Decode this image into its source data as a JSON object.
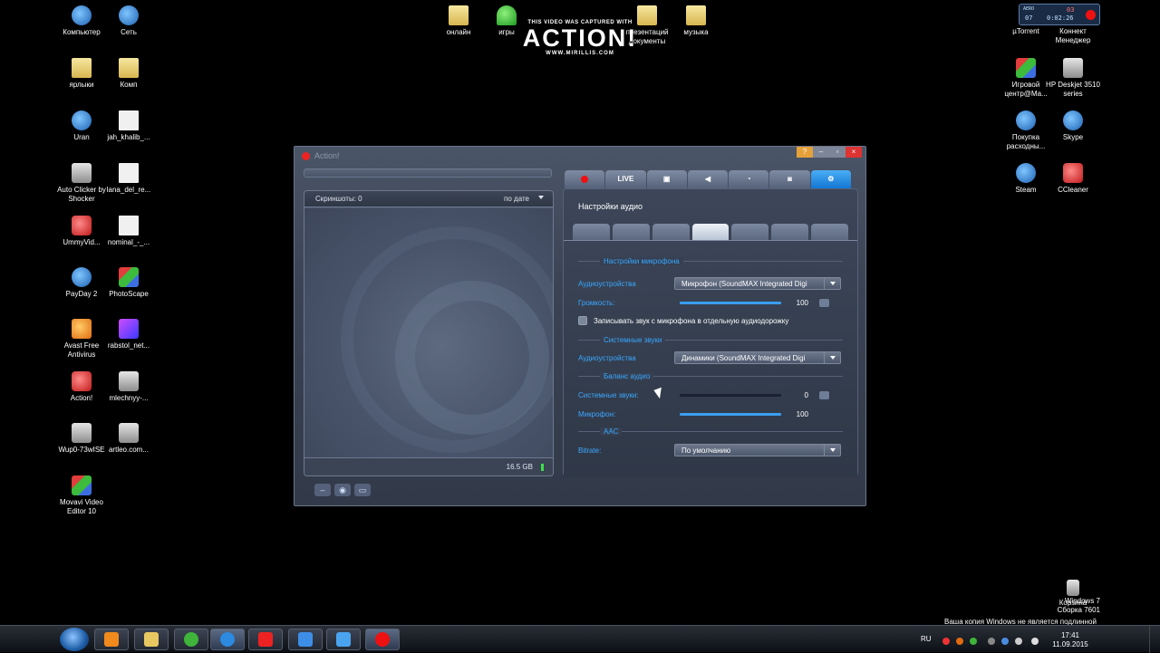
{
  "desktop": {
    "left_icons": [
      {
        "label": "Компьютер",
        "kind": "blue"
      },
      {
        "label": "Сеть",
        "kind": "blue"
      },
      {
        "label": "ярлыки",
        "kind": "folder"
      },
      {
        "label": "Комп",
        "kind": "folder"
      },
      {
        "label": "Uran",
        "kind": "blue"
      },
      {
        "label": "jah_khalib_...",
        "kind": "file"
      },
      {
        "label": "Auto Clicker by Shocker",
        "kind": "gray"
      },
      {
        "label": "lana_del_re...",
        "kind": "file"
      },
      {
        "label": "UmmyVid...",
        "kind": "red"
      },
      {
        "label": "nominal_-_...",
        "kind": "file"
      },
      {
        "label": "PayDay 2",
        "kind": "blue"
      },
      {
        "label": "PhotoScape",
        "kind": "mix"
      },
      {
        "label": "Avast Free Antivirus",
        "kind": "orange"
      },
      {
        "label": "rabstol_net...",
        "kind": "purple"
      },
      {
        "label": "Action!",
        "kind": "red"
      },
      {
        "label": "mlechnyy-...",
        "kind": "gray"
      },
      {
        "label": "Wup0-73wISE",
        "kind": "gray"
      },
      {
        "label": "artleo.com...",
        "kind": "gray"
      },
      {
        "label": "Movavi Video Editor 10",
        "kind": "mix"
      }
    ],
    "top_icons": [
      {
        "label": "онлайн",
        "kind": "folder"
      },
      {
        "label": "игры",
        "kind": "green"
      },
      {
        "label": "презентаций документы",
        "kind": "folder"
      },
      {
        "label": "музыка",
        "kind": "folder"
      }
    ],
    "right_icons": [
      {
        "label": "µTorrent",
        "kind": "green"
      },
      {
        "label": "Коннект Менеджер",
        "kind": "gray"
      },
      {
        "label": "Игровой центр@Ma...",
        "kind": "mix"
      },
      {
        "label": "HP Deskjet 3510 series",
        "kind": "gray"
      },
      {
        "label": "Покупка расходны...",
        "kind": "blue"
      },
      {
        "label": "Skype",
        "kind": "blue"
      },
      {
        "label": "Steam",
        "kind": "blue"
      },
      {
        "label": "CCleaner",
        "kind": "red"
      },
      {
        "label": "Корзина",
        "kind": "gray"
      }
    ],
    "recycle_label": "Корзина"
  },
  "watermark": {
    "top": "THIS VIDEO WAS CAPTURED WITH",
    "brand": "ACTION!",
    "url": "WWW.MIRILLIS.COM"
  },
  "widget": {
    "label": "AERO",
    "value1": "07",
    "value2": "0:02:26",
    "value3": "03"
  },
  "app": {
    "title": "Action!",
    "left": {
      "screens_label": "Скриншоты: 0",
      "sort_label": "по дате",
      "disk_free": "16.5 GB"
    },
    "tabs": [
      {
        "icon": "record-icon",
        "label": ""
      },
      {
        "icon": "live-icon",
        "label": "LIVE"
      },
      {
        "icon": "game-icon",
        "label": ""
      },
      {
        "icon": "speaker-icon",
        "label": ""
      },
      {
        "icon": "alarm-icon",
        "label": ""
      },
      {
        "icon": "camera-icon",
        "label": ""
      },
      {
        "icon": "gear-icon",
        "label": "⚙"
      }
    ],
    "settings_title": "Настройки аудио",
    "mic_section": "Настройки микрофона",
    "mic_device_label": "Аудиоустройства",
    "mic_device_value": "Микрофон (SoundMAX Integrated Digi",
    "volume_label": "Громкость:",
    "volume_value": "100",
    "volume_percent": 100,
    "separate_track_label": "Записывать звук с микрофона в отдельную аудиодорожку",
    "system_section": "Системные звуки",
    "sys_device_label": "Аудиоустройства",
    "sys_device_value": "Динамики (SoundMAX Integrated Digi",
    "balance_section": "Баланс аудио",
    "balance_sys_label": "Системные звуки:",
    "balance_sys_value": "0",
    "balance_sys_percent": 0,
    "balance_mic_label": "Микрофон:",
    "balance_mic_value": "100",
    "balance_mic_percent": 100,
    "aac_section": "AAC",
    "bitrate_label": "Bitrate:",
    "bitrate_value": "По умолчанию"
  },
  "taskbar": {
    "lang": "RU",
    "time": "17:41",
    "date": "11.09.2015"
  },
  "notice": {
    "line1": "Windows 7",
    "line2": "Сборка 7601",
    "line3": "Ваша копия Windows не является подлинной"
  },
  "colors": {
    "accent_blue": "#38a7ff",
    "active_tab": "#1376d4",
    "record_red": "#e11111"
  }
}
